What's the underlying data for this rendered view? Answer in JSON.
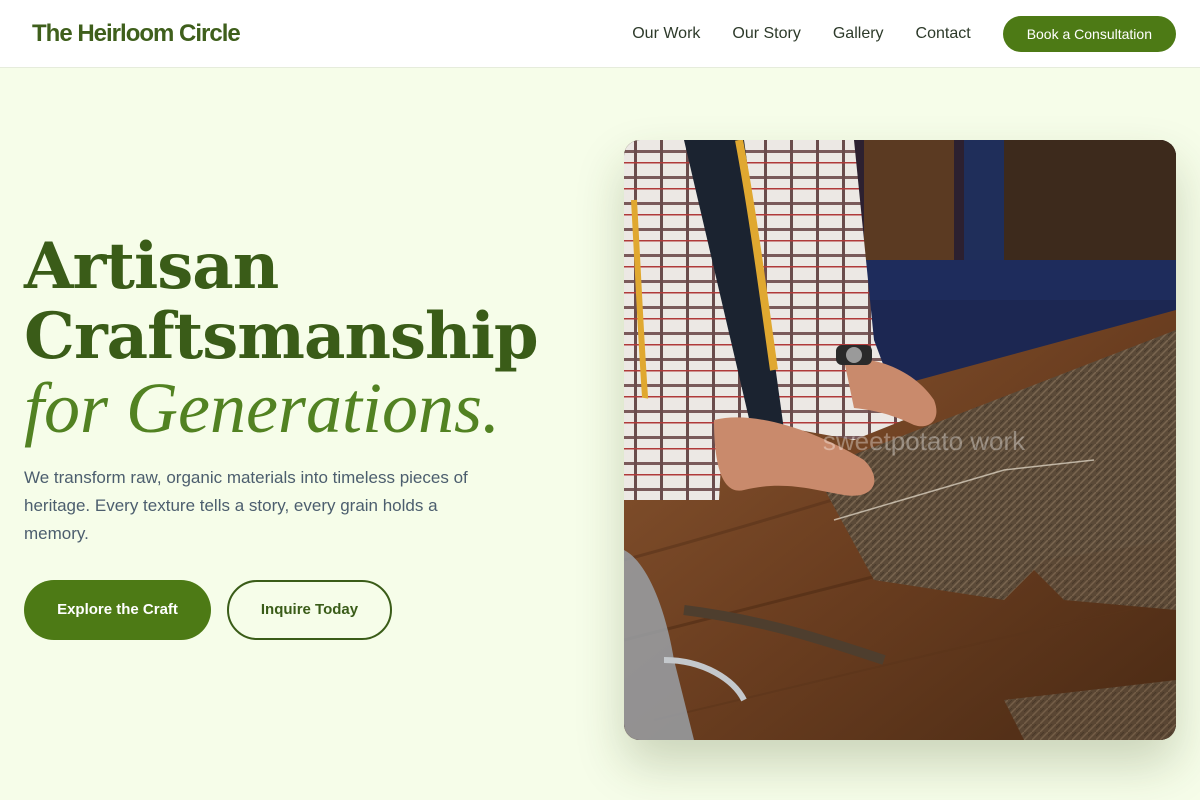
{
  "header": {
    "logo": "The Heirloom Circle",
    "nav": [
      {
        "label": "Our Work"
      },
      {
        "label": "Our Story"
      },
      {
        "label": "Gallery"
      },
      {
        "label": "Contact"
      }
    ],
    "cta_label": "Book a Consultation"
  },
  "hero": {
    "title_line1": "Artisan",
    "title_line2": "Craftsmanship",
    "title_line3": "for Generations.",
    "subtitle": "We transform raw, organic materials into timeless pieces of heritage. Every texture tells a story, every grain holds a memory.",
    "primary_button": "Explore the Craft",
    "secondary_button": "Inquire Today",
    "image_watermark": "sweetpotato work"
  },
  "colors": {
    "background": "#f6fde9",
    "brand": "#3a5c18",
    "accent": "#4d7a15"
  }
}
